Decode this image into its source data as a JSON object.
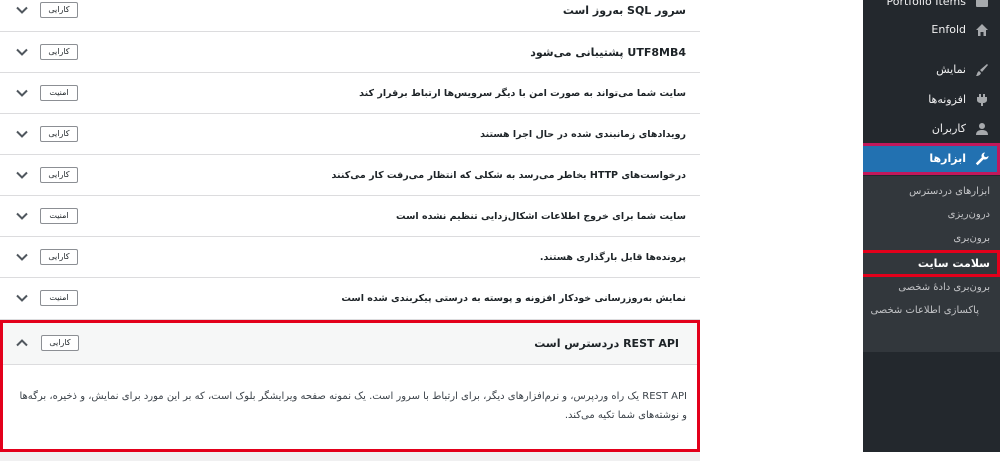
{
  "checks": [
    {
      "title": "سرور SQL به‌روز است",
      "badge": "کارایی"
    },
    {
      "title": "UTF8MB4 پشتیبانی می‌شود",
      "badge": "کارایی"
    },
    {
      "title": "سایت شما می‌تواند به صورت امن با دیگر سرویس‌ها ارتباط برقرار کند",
      "badge": "امنیت"
    },
    {
      "title": "رویدادهای زمانبندی شده در حال اجرا هستند",
      "badge": "کارایی"
    },
    {
      "title": "درخواست‌های HTTP بخاطر می‌رسد به شکلی که انتظار می‌رفت کار می‌کنند",
      "badge": "کارایی"
    },
    {
      "title": "سایت شما برای خروج اطلاعات اشکال‌زدایی تنظیم نشده است",
      "badge": "امنیت"
    },
    {
      "title": "پرونده‌ها قابل بارگذاری هستند.",
      "badge": "کارایی"
    },
    {
      "title": "نمایش به‌روزرسانی خودکار افزونه و پوسته به درستی پیکربندی شده است",
      "badge": "امنیت"
    }
  ],
  "expanded": {
    "title": "REST API دردسترس است",
    "badge": "کارایی",
    "body": "REST API یک راه وردپرس، و نرم‌افزارهای دیگر، برای ارتباط با سرور است. یک نمونه صفحه ویرایشگر بلوک است، که بر این مورد برای نمایش، و ذخیره، برگه‌ها و نوشته‌های شما تکیه می‌کند."
  },
  "sidebar": {
    "items": [
      {
        "label": "Portfolio Items",
        "icon": "portfolio-icon"
      },
      {
        "label": "Enfold",
        "icon": "home-icon"
      },
      {
        "label": "نمایش",
        "icon": "brush-icon"
      },
      {
        "label": "افزونه‌ها",
        "icon": "plugin-icon"
      },
      {
        "label": "کاربران",
        "icon": "user-icon"
      },
      {
        "label": "ابزارها",
        "icon": "wrench-icon"
      }
    ],
    "submenu": [
      "ابزارهای دردسترس",
      "درون‌ریزی",
      "برون‌بری",
      "سلامت سایت",
      "برون‌بری دادهٔ شخصی",
      "پاکسازی اطلاعات شخصی"
    ]
  },
  "colors": {
    "sidebar_bg": "#23282d",
    "active_menu": "#2271b1",
    "highlight_border": "#e3001b"
  }
}
